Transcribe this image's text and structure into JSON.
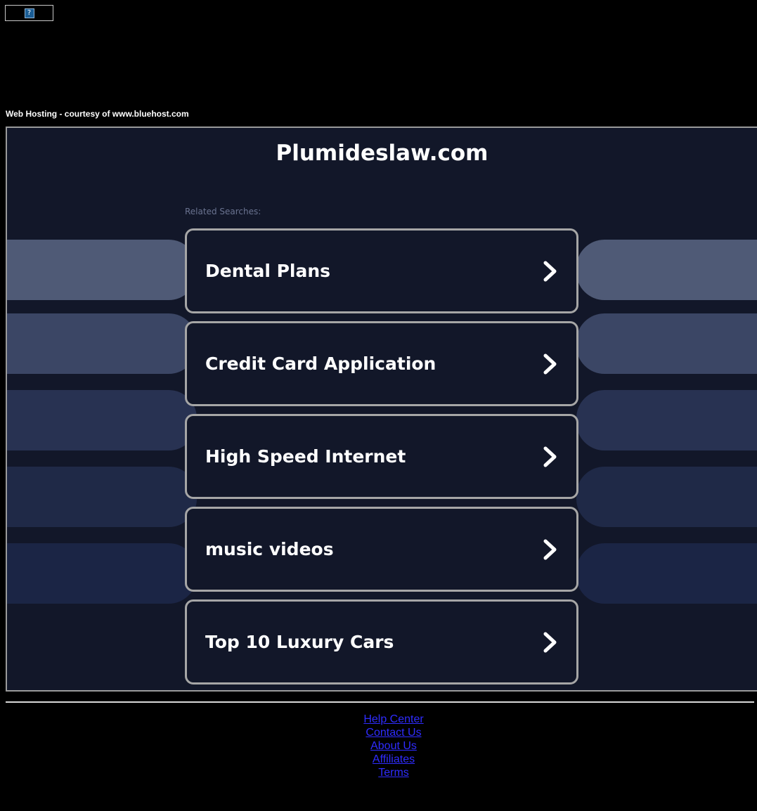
{
  "banner": {
    "icon": "question-mark-icon",
    "icon_glyph": "?"
  },
  "hosting_text": "Web Hosting - courtesy of www.bluehost.com",
  "site": {
    "title": "Plumideslaw.com",
    "related_label": "Related Searches:"
  },
  "searches": [
    {
      "label": "Dental Plans",
      "icon": "chevron-right-icon"
    },
    {
      "label": "Credit Card Application",
      "icon": "chevron-right-icon"
    },
    {
      "label": "High Speed Internet",
      "icon": "chevron-right-icon"
    },
    {
      "label": "music videos",
      "icon": "chevron-right-icon"
    },
    {
      "label": "Top 10 Luxury Cars",
      "icon": "chevron-right-icon"
    }
  ],
  "side_colors": [
    "#4f5a76",
    "#3b4665",
    "#283252",
    "#1f2947",
    "#1b2545"
  ],
  "footer": {
    "links": [
      "Help Center",
      "Contact Us",
      "About Us",
      "Affiliates",
      "Terms"
    ]
  },
  "colors": {
    "background": "#000000",
    "panel": "#121729",
    "card_border": "#a6a6a6",
    "link": "#2f2cff"
  }
}
